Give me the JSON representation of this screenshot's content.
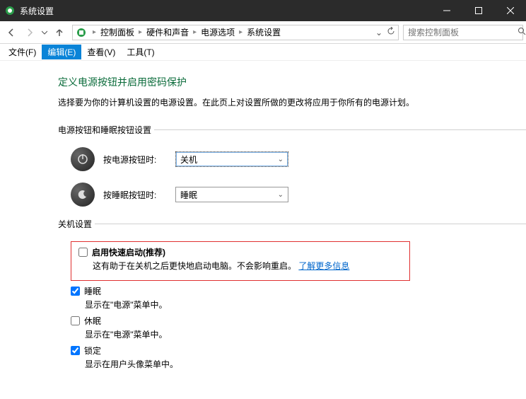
{
  "titlebar": {
    "title": "系统设置"
  },
  "breadcrumb": {
    "seg1": "控制面板",
    "seg2": "硬件和声音",
    "seg3": "电源选项",
    "seg4": "系统设置"
  },
  "searchbox": {
    "placeholder": "搜索控制面板"
  },
  "menubar": {
    "file": "文件(F)",
    "edit": "编辑(E)",
    "view": "查看(V)",
    "tools": "工具(T)"
  },
  "content": {
    "heading": "定义电源按钮并启用密码保护",
    "desc": "选择要为你的计算机设置的电源设置。在此页上对设置所做的更改将应用于你所有的电源计划。",
    "section_power": "电源按钮和睡眠按钮设置",
    "power_button_label": "按电源按钮时:",
    "power_button_value": "关机",
    "sleep_button_label": "按睡眠按钮时:",
    "sleep_button_value": "睡眠",
    "section_shutdown": "关机设置",
    "fast_startup": {
      "label": "启用快速启动(推荐)",
      "desc_prefix": "这有助于在关机之后更快地启动电脑。不会影响重启。",
      "link": "了解更多信息"
    },
    "sleep": {
      "label": "睡眠",
      "desc": "显示在\"电源\"菜单中。"
    },
    "hibernate": {
      "label": "休眠",
      "desc": "显示在\"电源\"菜单中。"
    },
    "lock": {
      "label": "锁定",
      "desc": "显示在用户头像菜单中。"
    }
  }
}
